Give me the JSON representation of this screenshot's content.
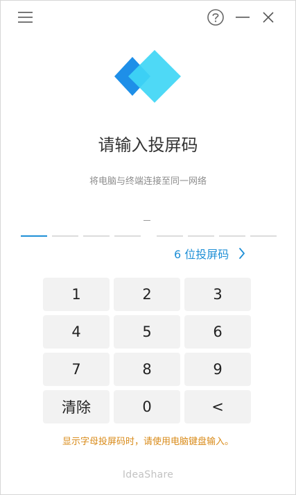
{
  "heading": {
    "title": "请输入投屏码",
    "subtitle": "将电脑与终端连接至同一网络"
  },
  "code_input": {
    "separator": "–",
    "slots": [
      "",
      "",
      "",
      "",
      "",
      "",
      "",
      ""
    ],
    "active_index": 0
  },
  "mode_link": {
    "label": "6 位投屏码"
  },
  "keypad": {
    "keys": [
      {
        "name": "key-1",
        "label": "1"
      },
      {
        "name": "key-2",
        "label": "2"
      },
      {
        "name": "key-3",
        "label": "3"
      },
      {
        "name": "key-4",
        "label": "4"
      },
      {
        "name": "key-5",
        "label": "5"
      },
      {
        "name": "key-6",
        "label": "6"
      },
      {
        "name": "key-7",
        "label": "7"
      },
      {
        "name": "key-8",
        "label": "8"
      },
      {
        "name": "key-9",
        "label": "9"
      },
      {
        "name": "clear-button",
        "label": "清除"
      },
      {
        "name": "key-0",
        "label": "0"
      },
      {
        "name": "backspace-button",
        "label": "<"
      }
    ]
  },
  "hint": "显示字母投屏码时，请使用电脑键盘输入。",
  "brand": "IdeaShare",
  "icons": {
    "menu": "menu-icon",
    "help": "help-icon",
    "minimize": "minimize-icon",
    "close": "close-icon",
    "chevron": "chevron-right-icon"
  },
  "colors": {
    "accent": "#1e8fd6",
    "hint": "#d98b1a",
    "logo_left": "#1e8fe8",
    "logo_right": "#3fd6f5"
  }
}
